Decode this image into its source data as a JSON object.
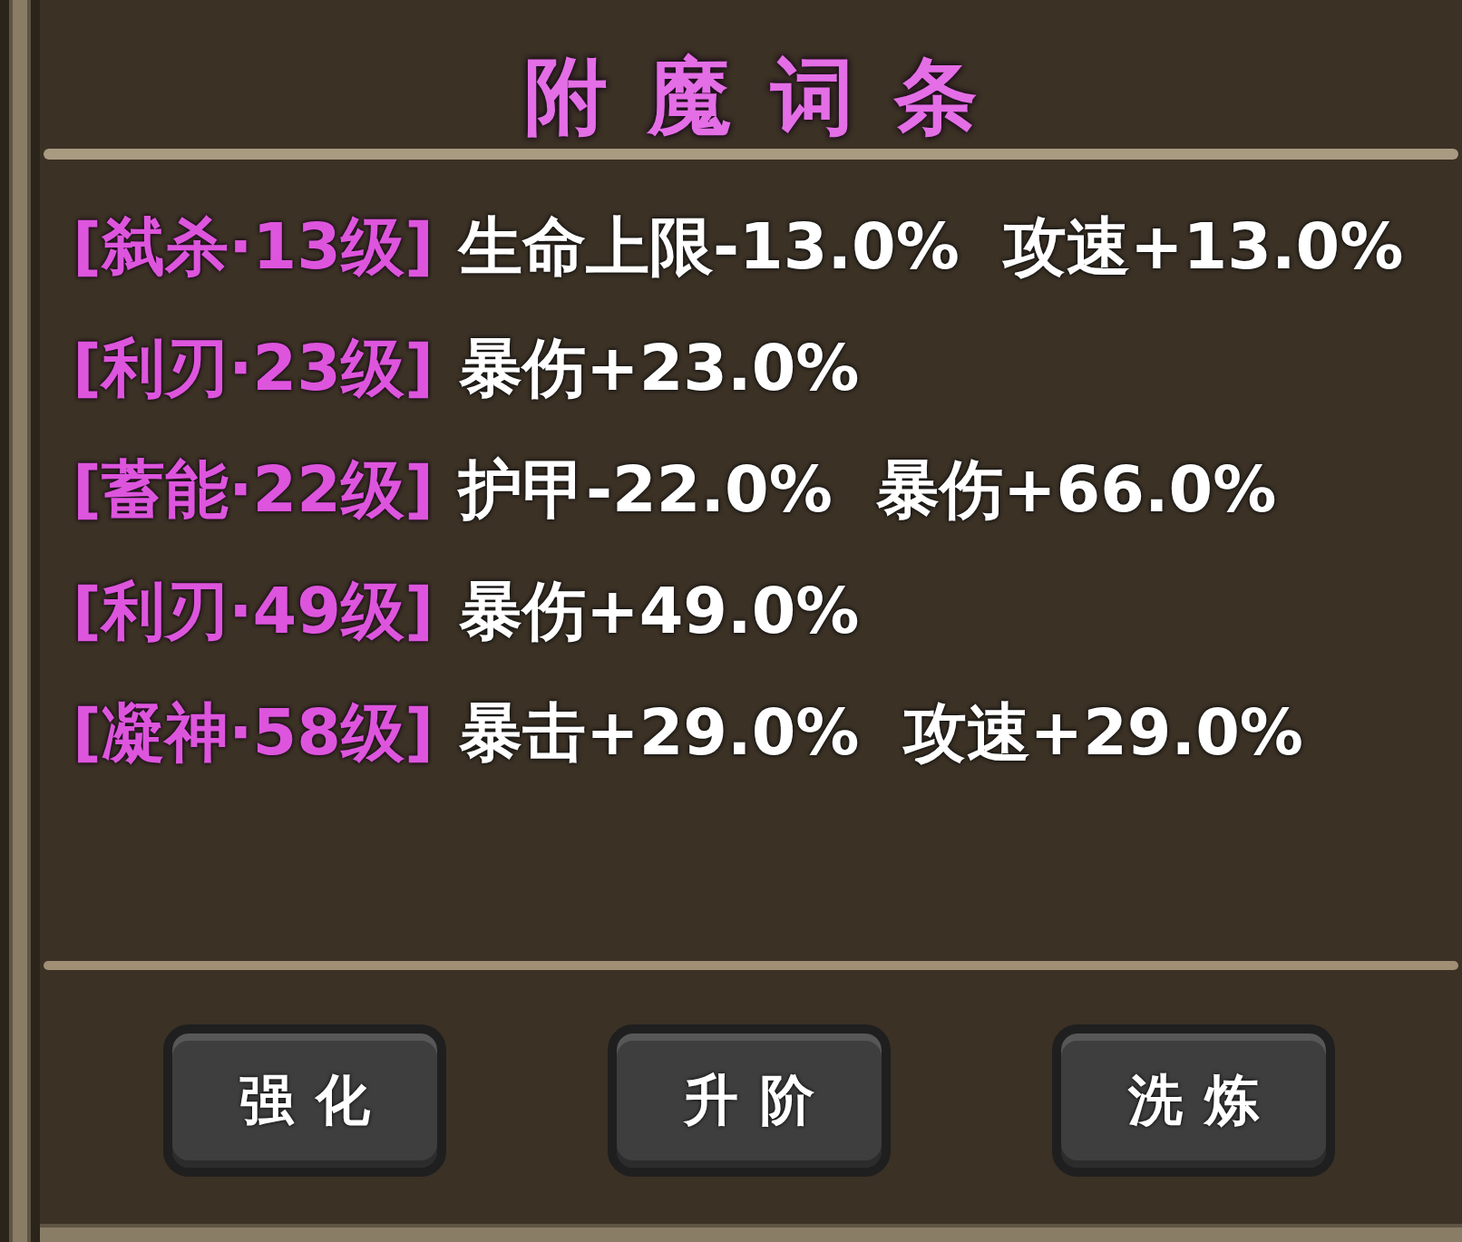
{
  "panel": {
    "title": "附魔词条"
  },
  "affixes": [
    {
      "tag": "[弑杀·13级]",
      "stats": [
        "生命上限-13.0%",
        "攻速+13.0%"
      ]
    },
    {
      "tag": "[利刃·23级]",
      "stats": [
        "暴伤+23.0%"
      ]
    },
    {
      "tag": "[蓄能·22级]",
      "stats": [
        "护甲-22.0%",
        "暴伤+66.0%"
      ]
    },
    {
      "tag": "[利刃·49级]",
      "stats": [
        "暴伤+49.0%"
      ]
    },
    {
      "tag": "[凝神·58级]",
      "stats": [
        "暴击+29.0%",
        "攻速+29.0%"
      ]
    }
  ],
  "buttons": [
    {
      "label": "强化"
    },
    {
      "label": "升阶"
    },
    {
      "label": "洗炼"
    }
  ]
}
